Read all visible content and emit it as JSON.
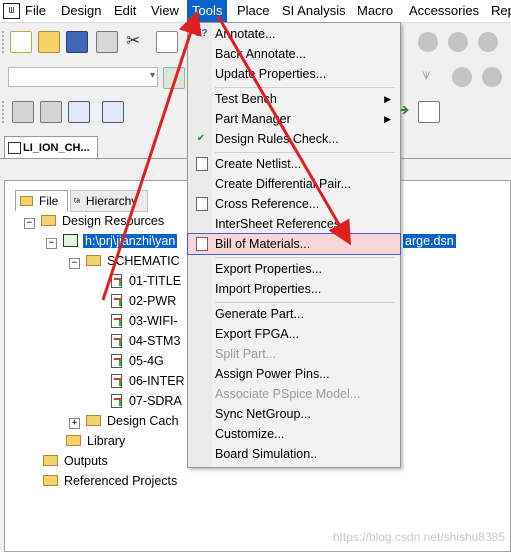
{
  "menubar": {
    "items": [
      "File",
      "Design",
      "Edit",
      "View",
      "Tools",
      "Place",
      "SI Analysis",
      "Macro",
      "Accessories",
      "Rep"
    ]
  },
  "doc_tab": {
    "label": "LI_ION_CH..."
  },
  "project": {
    "tabs": [
      "File",
      "Hierarchy"
    ],
    "tree": {
      "design_resources": "Design Resources",
      "dsn_path_left": "h:\\prj\\jianzhi\\yan",
      "dsn_path_right": "arge.dsn",
      "schematic": "SCHEMATIC",
      "pages": [
        "01-TITLE",
        "02-PWR",
        "03-WIFI-",
        "04-STM3",
        "05-4G",
        "06-INTER",
        "07-SDRA"
      ],
      "design_cache": "Design Cach",
      "library": "Library",
      "outputs": "Outputs",
      "referenced_projects": "Referenced Projects"
    }
  },
  "tools_menu": {
    "items": [
      {
        "label": "Annotate...",
        "icon": "annotate-icon",
        "disabled": false
      },
      {
        "label": "Back Annotate...",
        "icon": "",
        "disabled": false
      },
      {
        "label": "Update Properties...",
        "icon": "",
        "disabled": false
      },
      {
        "label": "Test Bench",
        "icon": "",
        "disabled": false,
        "submenu": true
      },
      {
        "label": "Part Manager",
        "icon": "",
        "disabled": false,
        "submenu": true
      },
      {
        "label": "Design Rules Check...",
        "icon": "drc-icon",
        "disabled": false
      },
      {
        "label": "Create Netlist...",
        "icon": "netlist-icon",
        "disabled": false
      },
      {
        "label": "Create Differential Pair...",
        "icon": "",
        "disabled": false
      },
      {
        "label": "Cross Reference...",
        "icon": "cross-reference-icon",
        "disabled": false
      },
      {
        "label": "InterSheet References...",
        "icon": "",
        "disabled": false
      },
      {
        "label": "Bill of Materials...",
        "icon": "bom-icon",
        "disabled": false,
        "highlighted": true
      },
      {
        "label": "Export Properties...",
        "icon": "",
        "disabled": false
      },
      {
        "label": "Import Properties...",
        "icon": "",
        "disabled": false
      },
      {
        "label": "Generate Part...",
        "icon": "",
        "disabled": false
      },
      {
        "label": "Export FPGA...",
        "icon": "",
        "disabled": false
      },
      {
        "label": "Split Part...",
        "icon": "",
        "disabled": true
      },
      {
        "label": "Assign Power Pins...",
        "icon": "",
        "disabled": false
      },
      {
        "label": "Associate PSpice Model...",
        "icon": "",
        "disabled": true
      },
      {
        "label": "Sync NetGroup...",
        "icon": "",
        "disabled": false
      },
      {
        "label": "Customize...",
        "icon": "",
        "disabled": false
      },
      {
        "label": "Board Simulation..",
        "icon": "",
        "disabled": false
      }
    ]
  },
  "watermark": "https://blog.csdn.net/shishu8385",
  "colors": {
    "accent": "#0a63c9",
    "highlight": "#fad6d6",
    "arrow": "#e02020"
  }
}
